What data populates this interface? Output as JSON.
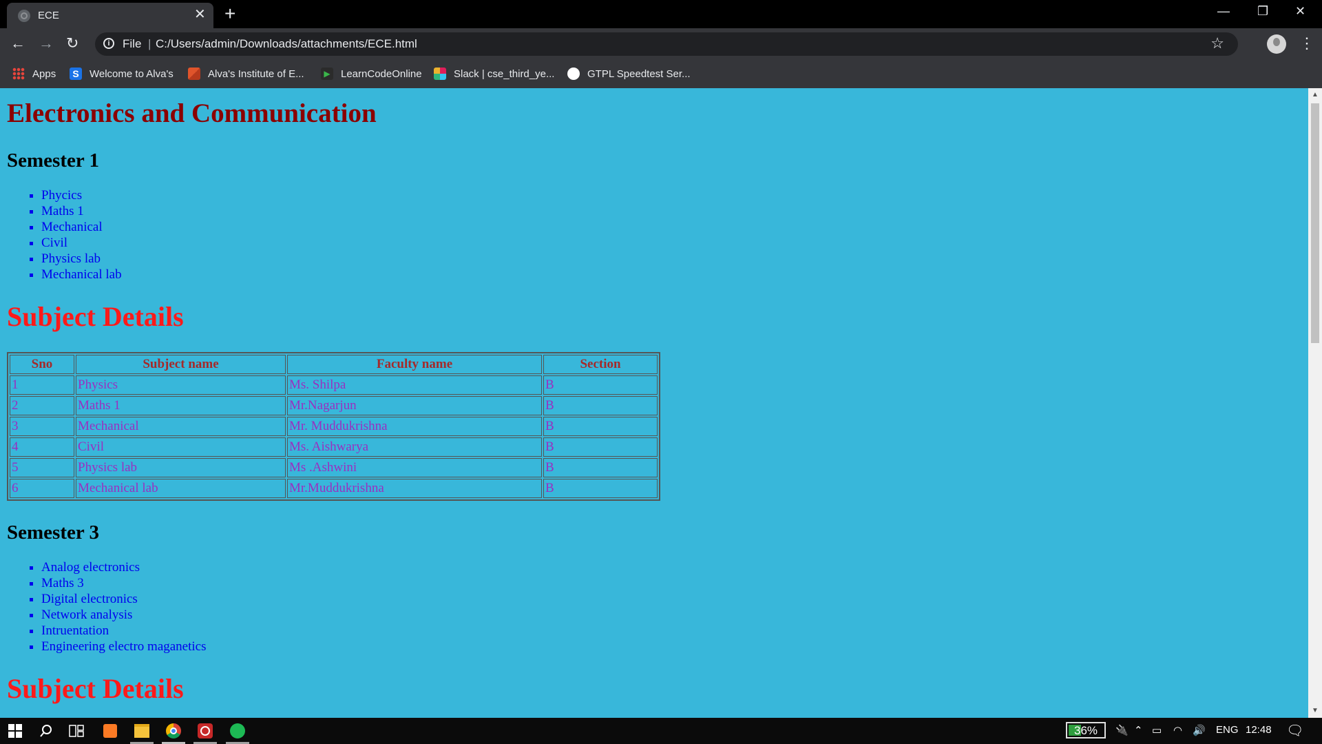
{
  "browser": {
    "tab_title": "ECE",
    "scheme_label": "File",
    "url": "C:/Users/admin/Downloads/attachments/ECE.html",
    "bookmarks": [
      {
        "label": "Apps",
        "icon": "apps-grid-icon",
        "color": "#e8453c"
      },
      {
        "label": "Welcome to Alva's",
        "icon": "alvas-s-icon",
        "color": "#1a73e8"
      },
      {
        "label": "Alva's Institute of E...",
        "icon": "alvas-institute-icon",
        "color": "#e0542b"
      },
      {
        "label": "LearnCodeOnline",
        "icon": "learncodeonline-icon",
        "color": "#3ab54a"
      },
      {
        "label": "Slack | cse_third_ye...",
        "icon": "slack-icon",
        "color": "#e01e5a"
      },
      {
        "label": "GTPL Speedtest Ser...",
        "icon": "speedtest-icon",
        "color": "#ffffff"
      }
    ]
  },
  "page": {
    "title": "Electronics and Communication",
    "semester1": {
      "heading": "Semester 1",
      "subjects": [
        "Phycics",
        "Maths 1",
        "Mechanical",
        "Civil",
        "Physics lab",
        "Mechanical lab"
      ]
    },
    "details1": {
      "heading": "Subject Details",
      "columns": [
        "Sno",
        "Subject name",
        "Faculty name",
        "Section"
      ],
      "rows": [
        [
          "1",
          "Physics",
          "Ms. Shilpa",
          "B"
        ],
        [
          "2",
          "Maths 1",
          "Mr.Nagarjun",
          "B"
        ],
        [
          "3",
          "Mechanical",
          "Mr. Muddukrishna",
          "B"
        ],
        [
          "4",
          "Civil",
          "Ms. Aishwarya",
          "B"
        ],
        [
          "5",
          "Physics lab",
          "Ms .Ashwini",
          "B"
        ],
        [
          "6",
          "Mechanical lab",
          "Mr.Muddukrishna",
          "B"
        ]
      ]
    },
    "semester3": {
      "heading": "Semester 3",
      "subjects": [
        "Analog electronics",
        "Maths 3",
        "Digital electronics",
        "Network analysis",
        "Intruentation",
        "Engineering electro maganetics"
      ]
    },
    "details2": {
      "heading": "Subject Details"
    }
  },
  "taskbar": {
    "battery_percent": 36,
    "battery_label": "36%",
    "language": "ENG",
    "time": "12:48",
    "pinned_apps": [
      "start-icon",
      "search-icon",
      "task-view-icon",
      "xampp-icon",
      "file-explorer-icon",
      "chrome-icon",
      "whatsapp-icon",
      "spotify-icon"
    ]
  },
  "colors": {
    "page_background": "#38b7da",
    "title_color": "#8b0000",
    "details_heading_color": "#ff1a1a",
    "link_color": "#0000ee",
    "table_cell_color": "#9a2fc0",
    "table_header_color": "#a52a2a"
  }
}
